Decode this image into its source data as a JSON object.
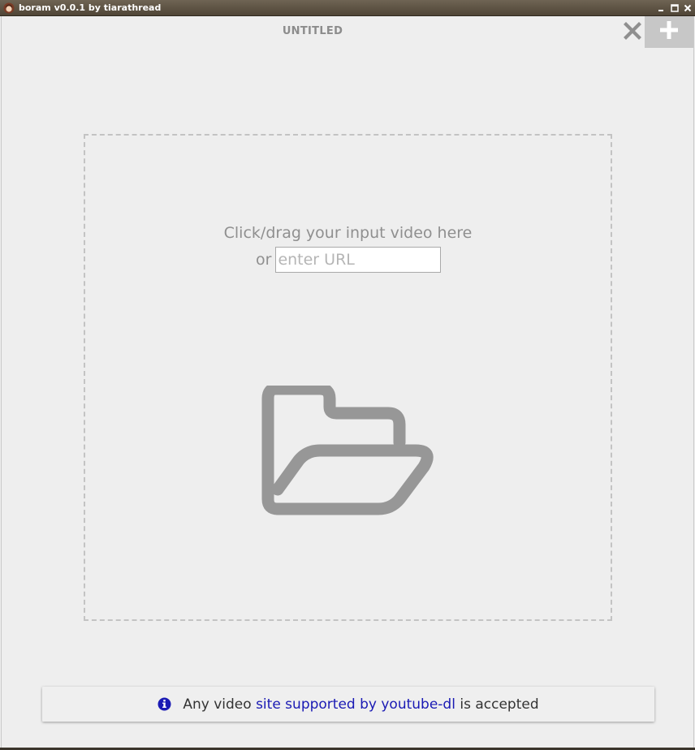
{
  "window": {
    "title": "boram v0.0.1 by tiarathread",
    "icons": {
      "app": "app-avatar-icon",
      "minimize": "minimize-icon",
      "maximize": "maximize-icon",
      "close": "close-icon"
    }
  },
  "toolbar": {
    "tab_title": "UNTITLED",
    "close_icon": "close-x-icon",
    "add_icon": "plus-icon"
  },
  "drop_zone": {
    "hint": "Click/drag your input video here",
    "or_label": "or",
    "url_placeholder": "enter URL",
    "url_value": "",
    "icon": "folder-open-icon"
  },
  "info": {
    "icon": "info-circle-icon",
    "prefix": "Any video",
    "link_text": "site supported by youtube-dl",
    "suffix": "is accepted"
  },
  "colors": {
    "background": "#eeeeee",
    "titlebar": "#5a5042",
    "muted_text": "#8f8f8f",
    "link": "#1a1ab4",
    "info_icon": "#1a1ab4",
    "new_tab_button": "#c7c7c7"
  }
}
